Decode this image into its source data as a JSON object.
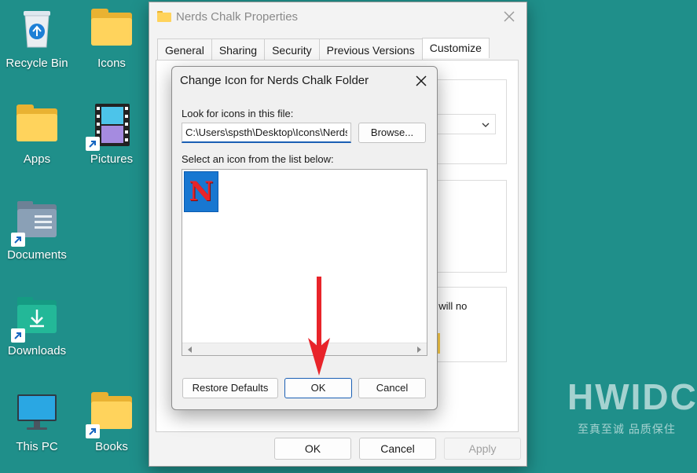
{
  "desktop": {
    "icons": [
      {
        "label": "Recycle Bin"
      },
      {
        "label": "Icons"
      },
      {
        "label": "Apps"
      },
      {
        "label": "Pictures"
      },
      {
        "label": "Documents"
      },
      {
        "label": "Downloads"
      },
      {
        "label": "This PC"
      },
      {
        "label": "Books"
      }
    ]
  },
  "properties_window": {
    "title": "Nerds Chalk Properties",
    "tabs": [
      "General",
      "Sharing",
      "Security",
      "Previous Versions",
      "Customize"
    ],
    "active_tab": "Customize",
    "partial_text": "t will no",
    "buttons": {
      "ok": "OK",
      "cancel": "Cancel",
      "apply": "Apply"
    }
  },
  "change_icon_dialog": {
    "title": "Change Icon for Nerds Chalk Folder",
    "look_label": "Look for icons in this file:",
    "path_value": "C:\\Users\\spsth\\Desktop\\Icons\\Nerds",
    "browse_button": "Browse...",
    "select_label": "Select an icon from the list below:",
    "icon_letter": "N",
    "buttons": {
      "restore": "Restore Defaults",
      "ok": "OK",
      "cancel": "Cancel"
    }
  },
  "watermark": {
    "brand": "HWIDC",
    "tagline": "至真至诚 品质保住"
  },
  "colors": {
    "desktop_bg": "#1f8f8a",
    "accent": "#1a5fb4",
    "arrow": "#e8242a",
    "icon_tile": "#1877d1",
    "icon_letter": "#e8242a"
  }
}
